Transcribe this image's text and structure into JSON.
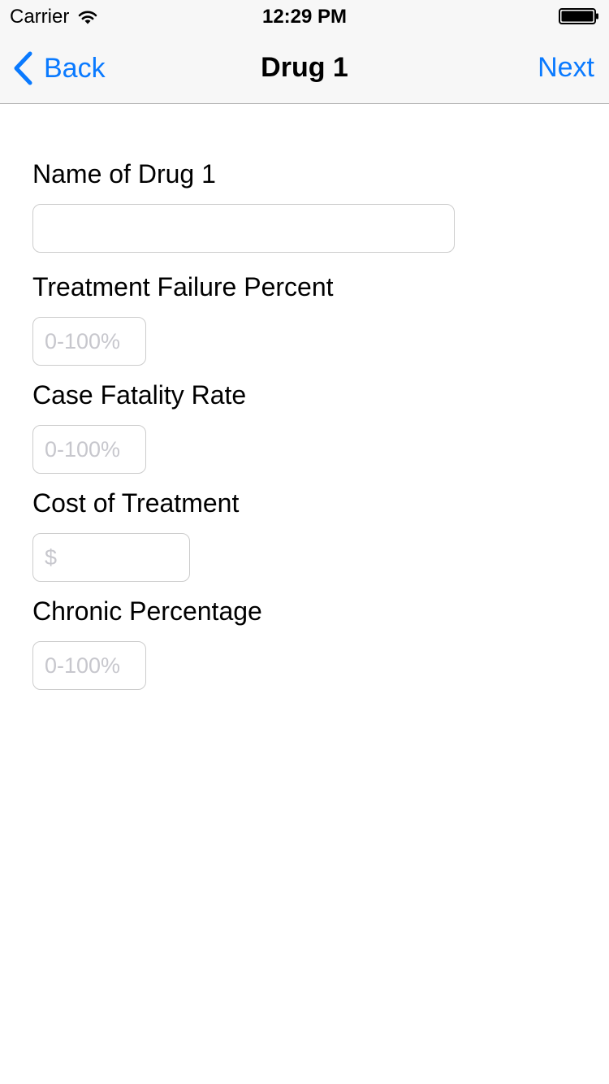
{
  "status_bar": {
    "carrier": "Carrier",
    "time": "12:29 PM"
  },
  "nav": {
    "back_label": "Back",
    "title": "Drug 1",
    "next_label": "Next"
  },
  "colors": {
    "accent": "#0a7aff",
    "bar_background": "#f7f7f7",
    "field_border": "#cccccc",
    "placeholder": "#c7c7cd"
  },
  "form": {
    "drug_name": {
      "label": "Name of Drug 1",
      "value": "",
      "placeholder": ""
    },
    "treatment_failure": {
      "label": "Treatment Failure Percent",
      "value": "",
      "placeholder": "0-100%"
    },
    "case_fatality": {
      "label": "Case Fatality Rate",
      "value": "",
      "placeholder": "0-100%"
    },
    "cost": {
      "label": "Cost of Treatment",
      "value": "",
      "placeholder": "$"
    },
    "chronic": {
      "label": "Chronic Percentage",
      "value": "",
      "placeholder": "0-100%"
    }
  },
  "icons": {
    "wifi": "wifi-icon",
    "battery": "battery-icon",
    "back": "chevron-left-icon"
  }
}
